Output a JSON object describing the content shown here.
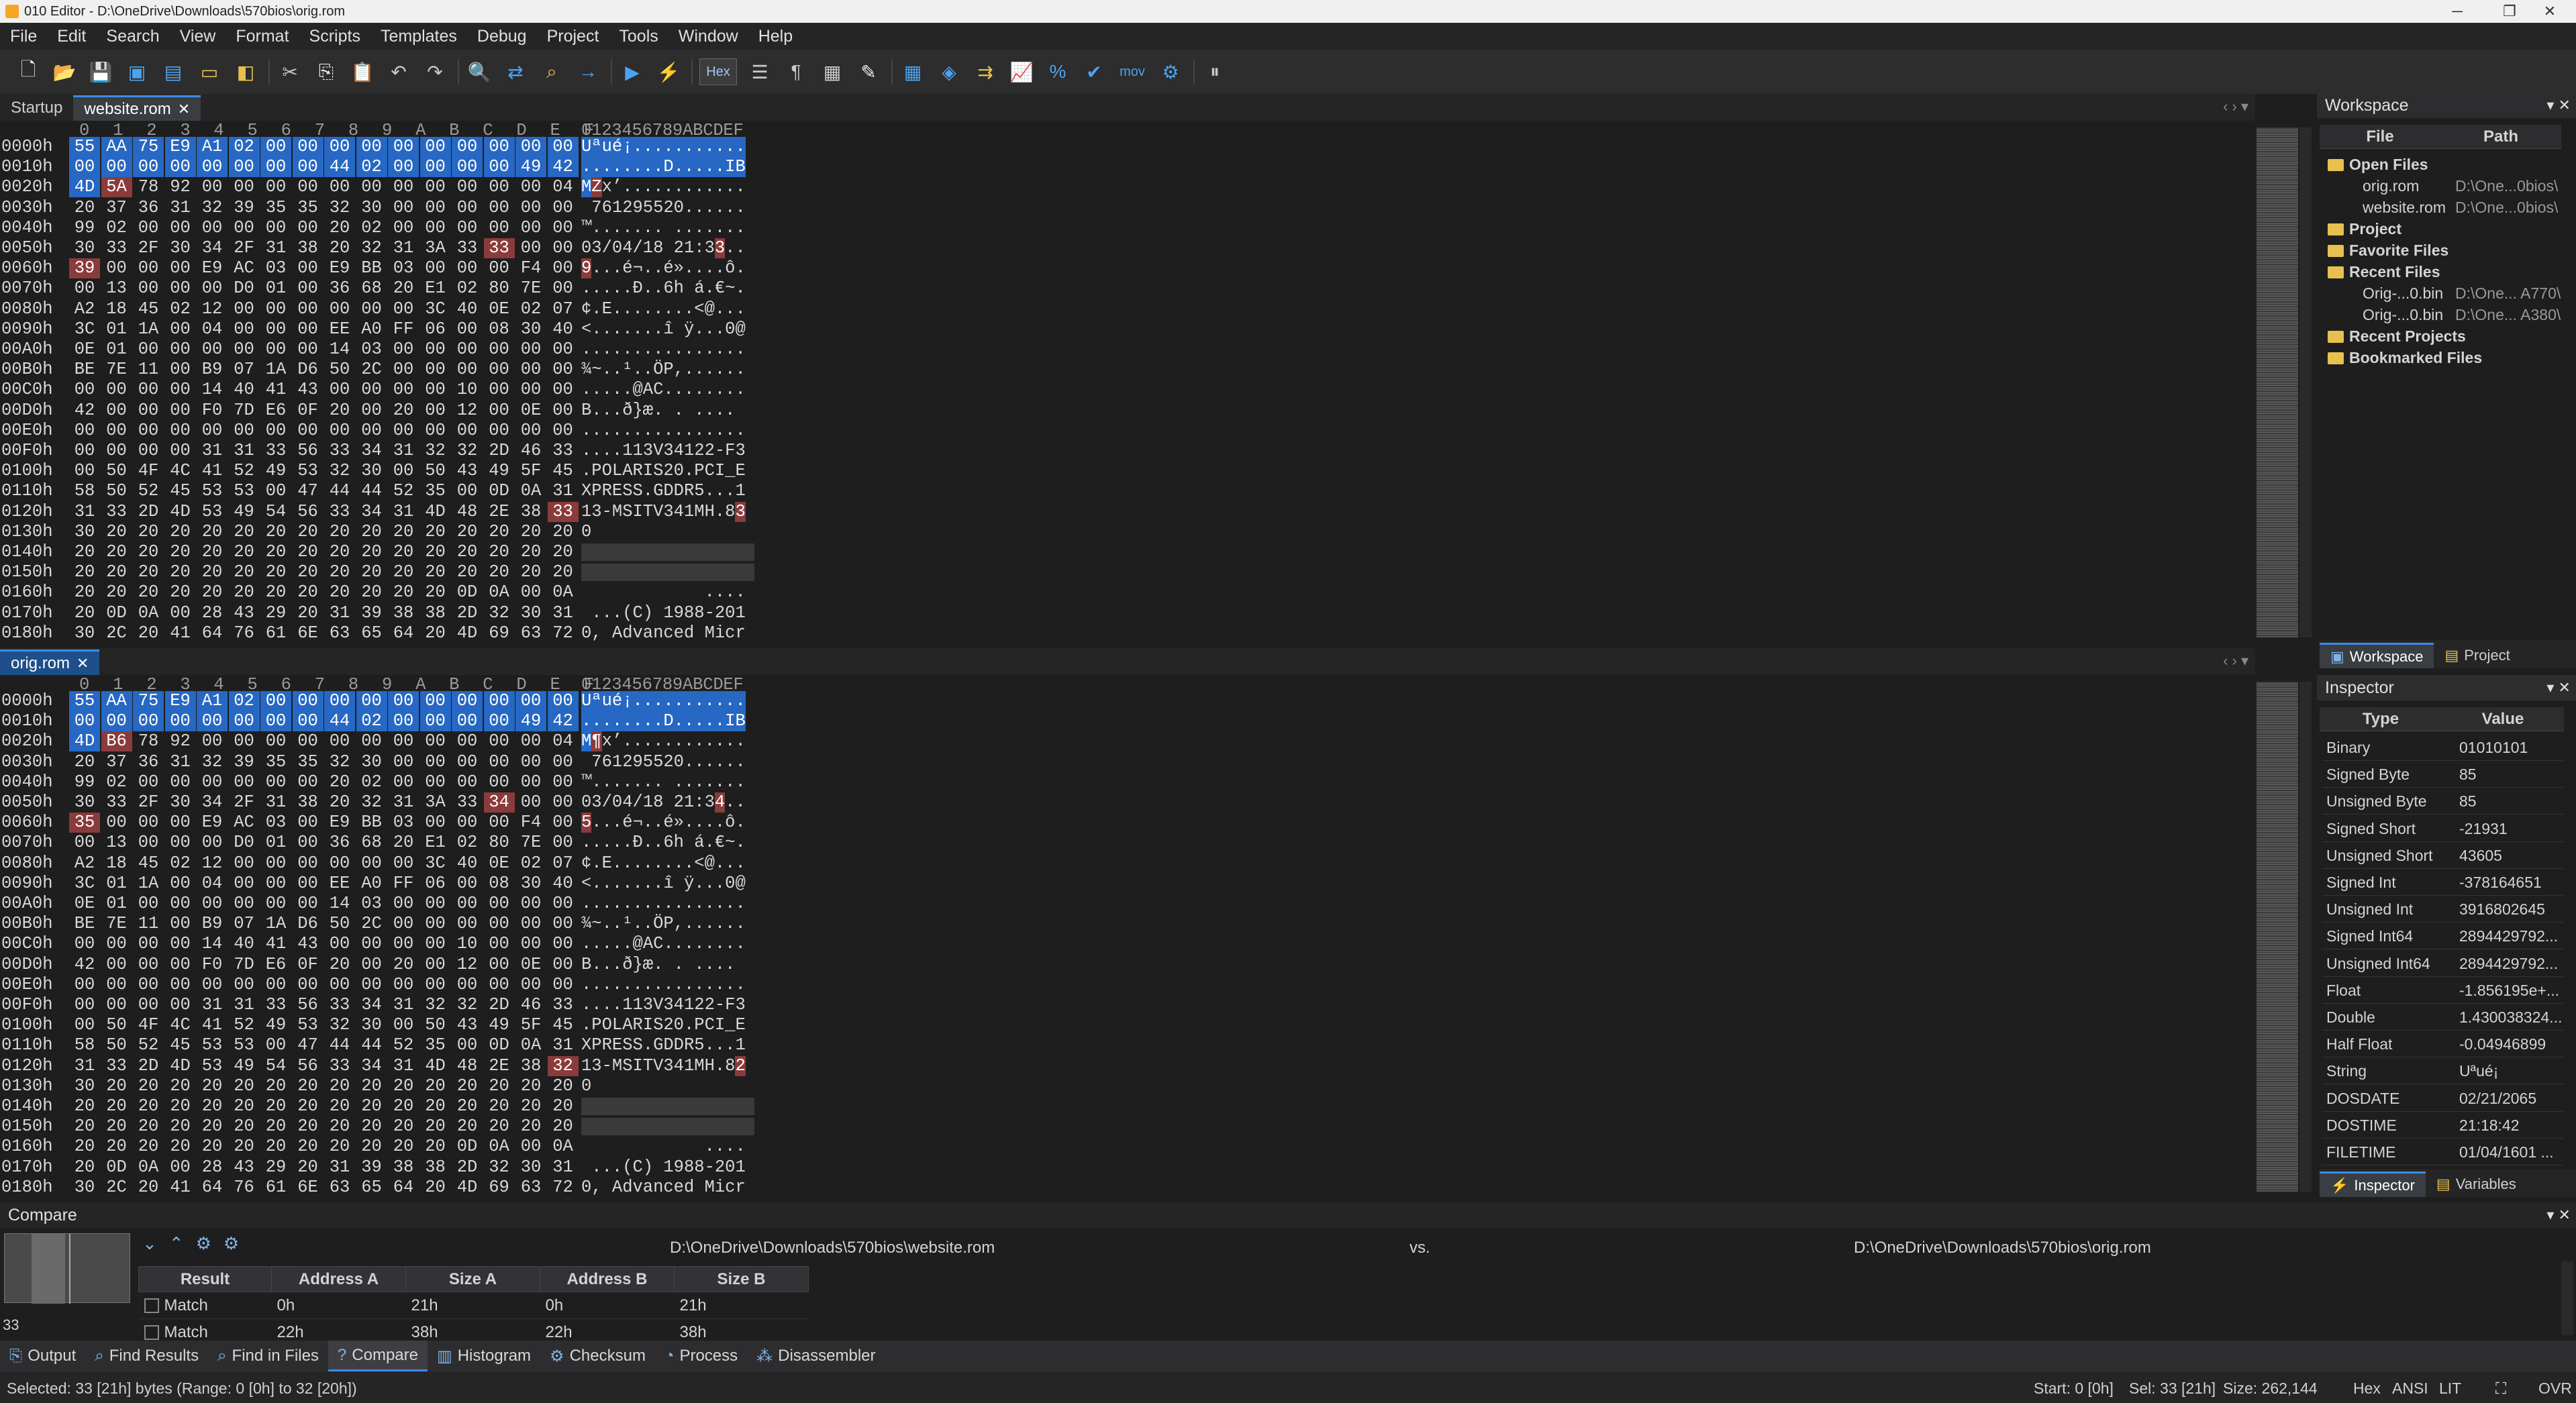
{
  "window": {
    "title": "010 Editor - D:\\OneDrive\\Downloads\\570bios\\orig.rom",
    "minimize": "─",
    "maximize": "❐",
    "close": "✕"
  },
  "menu": [
    "File",
    "Edit",
    "Search",
    "View",
    "Format",
    "Scripts",
    "Templates",
    "Debug",
    "Project",
    "Tools",
    "Window",
    "Help"
  ],
  "toolbar": {
    "hex_label": "Hex",
    "mov_label": "mov"
  },
  "tabs_top": [
    {
      "label": "Startup"
    },
    {
      "label": "website.rom",
      "close": "✕"
    }
  ],
  "tab_bottom": {
    "label": "orig.rom",
    "close": "✕"
  },
  "column_header_hex": "0  1  2  3  4  5  6  7  8  9  A  B  C  D  E  F",
  "column_header_ascii": "0123456789ABCDEF",
  "hex_top": {
    "rows": [
      {
        "addr": "0000h",
        "bytes": "55 AA 75 E9 A1 02 00 00 00 00 00 00 00 00 00 00",
        "ascii": "Uªué¡..........."
      },
      {
        "addr": "0010h",
        "bytes": "00 00 00 00 00 00 00 00 44 02 00 00 00 00 49 42",
        "ascii": "........D.....IB"
      },
      {
        "addr": "0020h",
        "bytes": "4D 5A 78 92 00 00 00 00 00 00 00 00 00 00 00 04",
        "ascii": "MZx’............"
      },
      {
        "addr": "0030h",
        "bytes": "20 37 36 31 32 39 35 35 32 30 00 00 00 00 00 00",
        "ascii": " 761295520......"
      },
      {
        "addr": "0040h",
        "bytes": "99 02 00 00 00 00 00 00 20 02 00 00 00 00 00 00",
        "ascii": "™....... ......."
      },
      {
        "addr": "0050h",
        "bytes": "30 33 2F 30 34 2F 31 38 20 32 31 3A 33 33 00 00",
        "ascii": "03/04/18 21:33.."
      },
      {
        "addr": "0060h",
        "bytes": "39 00 00 00 E9 AC 03 00 E9 BB 03 00 00 00 F4 00",
        "ascii": "9...é¬..é»....ô."
      },
      {
        "addr": "0070h",
        "bytes": "00 13 00 00 00 D0 01 00 36 68 20 E1 02 80 7E 00",
        "ascii": ".....Ð..6h á.€~."
      },
      {
        "addr": "0080h",
        "bytes": "A2 18 45 02 12 00 00 00 00 00 00 3C 40 0E 02 07",
        "ascii": "¢.E........<@..."
      },
      {
        "addr": "0090h",
        "bytes": "3C 01 1A 00 04 00 00 00 EE A0 FF 06 00 08 30 40",
        "ascii": "<.......î ÿ...0@"
      },
      {
        "addr": "00A0h",
        "bytes": "0E 01 00 00 00 00 00 00 14 03 00 00 00 00 00 00",
        "ascii": "................"
      },
      {
        "addr": "00B0h",
        "bytes": "BE 7E 11 00 B9 07 1A D6 50 2C 00 00 00 00 00 00",
        "ascii": "¾~..¹..ÖP,......"
      },
      {
        "addr": "00C0h",
        "bytes": "00 00 00 00 14 40 41 43 00 00 00 00 10 00 00 00",
        "ascii": ".....@AC........"
      },
      {
        "addr": "00D0h",
        "bytes": "42 00 00 00 F0 7D E6 0F 20 00 20 00 12 00 0E 00",
        "ascii": "B...ð}æ. . ...."
      },
      {
        "addr": "00E0h",
        "bytes": "00 00 00 00 00 00 00 00 00 00 00 00 00 00 00 00",
        "ascii": "................"
      },
      {
        "addr": "00F0h",
        "bytes": "00 00 00 00 31 31 33 56 33 34 31 32 32 2D 46 33",
        "ascii": "....113V34122-F3"
      },
      {
        "addr": "0100h",
        "bytes": "00 50 4F 4C 41 52 49 53 32 30 00 50 43 49 5F 45",
        "ascii": ".POLARIS20.PCI_E"
      },
      {
        "addr": "0110h",
        "bytes": "58 50 52 45 53 53 00 47 44 44 52 35 00 0D 0A 31",
        "ascii": "XPRESS.GDDR5...1"
      },
      {
        "addr": "0120h",
        "bytes": "31 33 2D 4D 53 49 54 56 33 34 31 4D 48 2E 38 33",
        "ascii": "13-MSITV341MH.83"
      },
      {
        "addr": "0130h",
        "bytes": "30 20 20 20 20 20 20 20 20 20 20 20 20 20 20 20",
        "ascii": "0"
      },
      {
        "addr": "0140h",
        "bytes": "20 20 20 20 20 20 20 20 20 20 20 20 20 20 20 20",
        "ascii": ""
      },
      {
        "addr": "0150h",
        "bytes": "20 20 20 20 20 20 20 20 20 20 20 20 20 20 20 20",
        "ascii": ""
      },
      {
        "addr": "0160h",
        "bytes": "20 20 20 20 20 20 20 20 20 20 20 20 0D 0A 00 0A",
        "ascii": "            ...."
      },
      {
        "addr": "0170h",
        "bytes": "20 0D 0A 00 28 43 29 20 31 39 38 38 2D 32 30 31",
        "ascii": " ...(C) 1988-201"
      },
      {
        "addr": "0180h",
        "bytes": "30 2C 20 41 64 76 61 6E 63 65 64 20 4D 69 63 72",
        "ascii": "0, Advanced Micr"
      }
    ]
  },
  "hex_bottom": {
    "rows": [
      {
        "addr": "0000h",
        "bytes": "55 AA 75 E9 A1 02 00 00 00 00 00 00 00 00 00 00",
        "ascii": "Uªué¡..........."
      },
      {
        "addr": "0010h",
        "bytes": "00 00 00 00 00 00 00 00 44 02 00 00 00 00 49 42",
        "ascii": "........D.....IB"
      },
      {
        "addr": "0020h",
        "bytes": "4D B6 78 92 00 00 00 00 00 00 00 00 00 00 00 04",
        "ascii": "M¶x’............"
      },
      {
        "addr": "0030h",
        "bytes": "20 37 36 31 32 39 35 35 32 30 00 00 00 00 00 00",
        "ascii": " 761295520......"
      },
      {
        "addr": "0040h",
        "bytes": "99 02 00 00 00 00 00 00 20 02 00 00 00 00 00 00",
        "ascii": "™....... ......."
      },
      {
        "addr": "0050h",
        "bytes": "30 33 2F 30 34 2F 31 38 20 32 31 3A 33 34 00 00",
        "ascii": "03/04/18 21:34.."
      },
      {
        "addr": "0060h",
        "bytes": "35 00 00 00 E9 AC 03 00 E9 BB 03 00 00 00 F4 00",
        "ascii": "5...é¬..é»....ô."
      },
      {
        "addr": "0070h",
        "bytes": "00 13 00 00 00 D0 01 00 36 68 20 E1 02 80 7E 00",
        "ascii": ".....Ð..6h á.€~."
      },
      {
        "addr": "0080h",
        "bytes": "A2 18 45 02 12 00 00 00 00 00 00 3C 40 0E 02 07",
        "ascii": "¢.E........<@..."
      },
      {
        "addr": "0090h",
        "bytes": "3C 01 1A 00 04 00 00 00 EE A0 FF 06 00 08 30 40",
        "ascii": "<.......î ÿ...0@"
      },
      {
        "addr": "00A0h",
        "bytes": "0E 01 00 00 00 00 00 00 14 03 00 00 00 00 00 00",
        "ascii": "................"
      },
      {
        "addr": "00B0h",
        "bytes": "BE 7E 11 00 B9 07 1A D6 50 2C 00 00 00 00 00 00",
        "ascii": "¾~..¹..ÖP,......"
      },
      {
        "addr": "00C0h",
        "bytes": "00 00 00 00 14 40 41 43 00 00 00 00 10 00 00 00",
        "ascii": ".....@AC........"
      },
      {
        "addr": "00D0h",
        "bytes": "42 00 00 00 F0 7D E6 0F 20 00 20 00 12 00 0E 00",
        "ascii": "B...ð}æ. . ...."
      },
      {
        "addr": "00E0h",
        "bytes": "00 00 00 00 00 00 00 00 00 00 00 00 00 00 00 00",
        "ascii": "................"
      },
      {
        "addr": "00F0h",
        "bytes": "00 00 00 00 31 31 33 56 33 34 31 32 32 2D 46 33",
        "ascii": "....113V34122-F3"
      },
      {
        "addr": "0100h",
        "bytes": "00 50 4F 4C 41 52 49 53 32 30 00 50 43 49 5F 45",
        "ascii": ".POLARIS20.PCI_E"
      },
      {
        "addr": "0110h",
        "bytes": "58 50 52 45 53 53 00 47 44 44 52 35 00 0D 0A 31",
        "ascii": "XPRESS.GDDR5...1"
      },
      {
        "addr": "0120h",
        "bytes": "31 33 2D 4D 53 49 54 56 33 34 31 4D 48 2E 38 32",
        "ascii": "13-MSITV341MH.82"
      },
      {
        "addr": "0130h",
        "bytes": "30 20 20 20 20 20 20 20 20 20 20 20 20 20 20 20",
        "ascii": "0"
      },
      {
        "addr": "0140h",
        "bytes": "20 20 20 20 20 20 20 20 20 20 20 20 20 20 20 20",
        "ascii": ""
      },
      {
        "addr": "0150h",
        "bytes": "20 20 20 20 20 20 20 20 20 20 20 20 20 20 20 20",
        "ascii": ""
      },
      {
        "addr": "0160h",
        "bytes": "20 20 20 20 20 20 20 20 20 20 20 20 0D 0A 00 0A",
        "ascii": "            ...."
      },
      {
        "addr": "0170h",
        "bytes": "20 0D 0A 00 28 43 29 20 31 39 38 38 2D 32 30 31",
        "ascii": " ...(C) 1988-201"
      },
      {
        "addr": "0180h",
        "bytes": "30 2C 20 41 64 76 61 6E 63 65 64 20 4D 69 63 72",
        "ascii": "0, Advanced Micr"
      }
    ]
  },
  "colors": {
    "selection": "#2668c4",
    "difference": "#8a3b3b",
    "accent": "#3c8ce6"
  },
  "workspace": {
    "title": "Workspace",
    "col_file": "File",
    "col_path": "Path",
    "open_files": "Open Files",
    "open_file_items": [
      {
        "name": "orig.rom",
        "path": "D:\\One...0bios\\"
      },
      {
        "name": "website.rom",
        "path": "D:\\One...0bios\\"
      }
    ],
    "project": "Project",
    "favorite_files": "Favorite Files",
    "recent_files": "Recent Files",
    "recent_items": [
      {
        "name": "Orig-...0.bin",
        "path": "D:\\One... A770\\"
      },
      {
        "name": "Orig-...0.bin",
        "path": "D:\\One... A380\\"
      }
    ],
    "recent_projects": "Recent Projects",
    "bookmarked_files": "Bookmarked Files",
    "tab_workspace": "Workspace",
    "tab_project": "Project"
  },
  "inspector": {
    "title": "Inspector",
    "col_type": "Type",
    "col_value": "Value",
    "rows": [
      {
        "type": "Binary",
        "value": "01010101"
      },
      {
        "type": "Signed Byte",
        "value": "85"
      },
      {
        "type": "Unsigned Byte",
        "value": "85"
      },
      {
        "type": "Signed Short",
        "value": "-21931"
      },
      {
        "type": "Unsigned Short",
        "value": "43605"
      },
      {
        "type": "Signed Int",
        "value": "-378164651"
      },
      {
        "type": "Unsigned Int",
        "value": "3916802645"
      },
      {
        "type": "Signed Int64",
        "value": "2894429792..."
      },
      {
        "type": "Unsigned Int64",
        "value": "2894429792..."
      },
      {
        "type": "Float",
        "value": "-1.856195e+..."
      },
      {
        "type": "Double",
        "value": "1.430038324..."
      },
      {
        "type": "Half Float",
        "value": "-0.04946899"
      },
      {
        "type": "String",
        "value": "Uªué¡"
      },
      {
        "type": "DOSDATE",
        "value": "02/21/2065"
      },
      {
        "type": "DOSTIME",
        "value": "21:18:42"
      },
      {
        "type": "FILETIME",
        "value": "01/04/1601 ..."
      }
    ],
    "tab_inspector": "Inspector",
    "tab_variables": "Variables"
  },
  "compare": {
    "title": "Compare",
    "file_a": "D:\\OneDrive\\Downloads\\570bios\\website.rom",
    "vs": "vs.",
    "file_b": "D:\\OneDrive\\Downloads\\570bios\\orig.rom",
    "thumb_count": "33",
    "headers": [
      "Result",
      "Address A",
      "Size A",
      "Address B",
      "Size B"
    ],
    "rows": [
      {
        "result": "Match",
        "addr_a": "0h",
        "size_a": "21h",
        "addr_b": "0h",
        "size_b": "21h"
      },
      {
        "result": "Match",
        "addr_a": "22h",
        "size_a": "38h",
        "addr_b": "22h",
        "size_b": "38h"
      }
    ]
  },
  "bottom_tabs": [
    {
      "label": "Output",
      "icon": "output-icon",
      "glyph": "⎘"
    },
    {
      "label": "Find Results",
      "icon": "find-results-icon",
      "glyph": "⌕"
    },
    {
      "label": "Find in Files",
      "icon": "find-in-files-icon",
      "glyph": "⌕"
    },
    {
      "label": "Compare",
      "icon": "compare-icon",
      "glyph": "?"
    },
    {
      "label": "Histogram",
      "icon": "histogram-icon",
      "glyph": "▥"
    },
    {
      "label": "Checksum",
      "icon": "checksum-icon",
      "glyph": "⚙"
    },
    {
      "label": "Process",
      "icon": "process-icon",
      "glyph": "◔"
    },
    {
      "label": "Disassembler",
      "icon": "disassembler-icon",
      "glyph": "⁂"
    }
  ],
  "status": {
    "selected": "Selected: 33 [21h] bytes (Range: 0 [0h] to 32 [20h])",
    "start": "Start: 0 [0h]",
    "sel": "Sel: 33 [21h]",
    "size": "Size: 262,144",
    "hex": "Hex",
    "ansi": "ANSI",
    "lit": "LIT",
    "ovr": "OVR"
  }
}
